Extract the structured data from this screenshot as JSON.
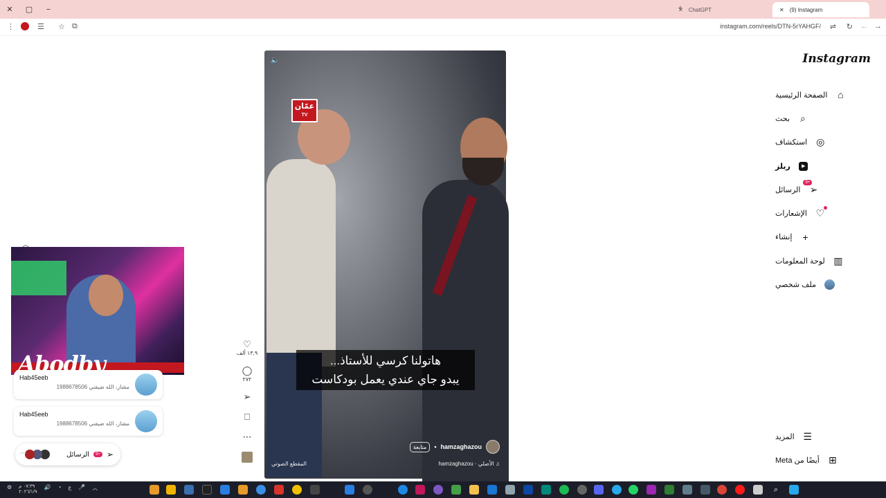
{
  "browser": {
    "tabs": [
      {
        "label": "ChatGPT",
        "active": false
      },
      {
        "label": "(9) Instagram",
        "active": true
      }
    ],
    "url": "instagram.com/reels/DTN-5rYAHGF/"
  },
  "sidebar": {
    "logo": "Instagram",
    "items": [
      {
        "label": "الصفحة الرئيسية",
        "icon": "home-icon"
      },
      {
        "label": "بحث",
        "icon": "search-icon"
      },
      {
        "label": "استكشاف",
        "icon": "compass-icon"
      },
      {
        "label": "ريلز",
        "icon": "reels-icon"
      },
      {
        "label": "الرسائل",
        "icon": "messages-icon",
        "badge": "+9"
      },
      {
        "label": "الإشعارات",
        "icon": "heart-icon"
      },
      {
        "label": "إنشاء",
        "icon": "plus-icon"
      },
      {
        "label": "لوحة المعلومات",
        "icon": "dashboard-icon"
      },
      {
        "label": "ملف شخصي",
        "icon": "profile-avatar"
      }
    ],
    "bottom": [
      {
        "label": "المزيد",
        "icon": "menu-icon"
      },
      {
        "label": "أيضًا من Meta",
        "icon": "meta-icon"
      }
    ]
  },
  "reel": {
    "channel_logo": "عمّان",
    "channel_logo_sub": "TV",
    "caption_line1": "هاتولنا كرسي للأستاذ...",
    "caption_line2": "يبدو جاي عندي يعمل بودكاست",
    "author": "hamzaghazou",
    "follow_label": "متابعة",
    "audio_author": "hamzaghazou",
    "audio_label": "الأصلي",
    "audio_clip_label": "المقطع الصوتي"
  },
  "actions": {
    "likes": "١٣,٩ ألف",
    "comments": "٢٧٢"
  },
  "webcam": {
    "brand": "Abodby"
  },
  "notifications": [
    {
      "user": "Hab45eeb",
      "message": "مشاز، الله ضيفني 1988678506"
    },
    {
      "user": "Hab45eeb",
      "message": "مشاز، الله ضيفني 1988678506"
    }
  ],
  "messages_bar": {
    "label": "الرسائل",
    "badge": "+9"
  },
  "taskbar": {
    "time": "٠٧:٣٩ م",
    "date": "٢٠٢٦/١/٩",
    "lang": "ع"
  },
  "colors": {
    "accent_red": "#e0245e",
    "tab_strip": "#f6d3d3",
    "taskbar": "#1b1e28"
  }
}
